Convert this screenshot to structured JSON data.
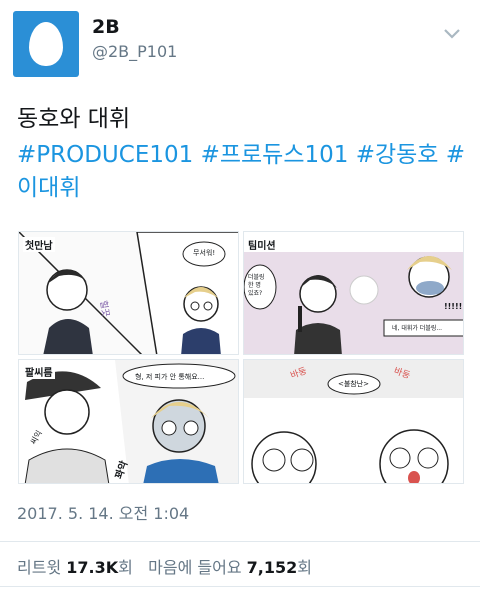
{
  "user": {
    "name": "2B",
    "handle": "@2B_P101"
  },
  "tweet": {
    "line1": "동호와 대휘",
    "hashtags": [
      "#PRODUCE101",
      "#프로듀스101",
      "#강동호",
      "#이대휘"
    ]
  },
  "media": {
    "panel1": {
      "label": "첫만남",
      "bubble": "무서워!",
      "sfx": "힐끗"
    },
    "panel2": {
      "label": "팀미션",
      "bubble": "더블링\n한 명\n있죠?",
      "exclaim": "!!!!!",
      "caption": "네, 대휘가 더블링..."
    },
    "panel3": {
      "label": "팔씨름",
      "bubble": "형, 저 피가 안 통해요...",
      "sfx1": "꽈악",
      "sfx2": "씨익"
    },
    "panel4": {
      "label": "<불참난>",
      "sfx1": "바둥",
      "sfx2": "바둥"
    }
  },
  "meta": {
    "timestamp": "2017. 5. 14. 오전 1:04",
    "retweets_label": "리트윗",
    "retweets_count": "17.3K",
    "retweets_unit": "회",
    "likes_label": "마음에 들어요",
    "likes_count": "7,152",
    "likes_unit": "회"
  }
}
